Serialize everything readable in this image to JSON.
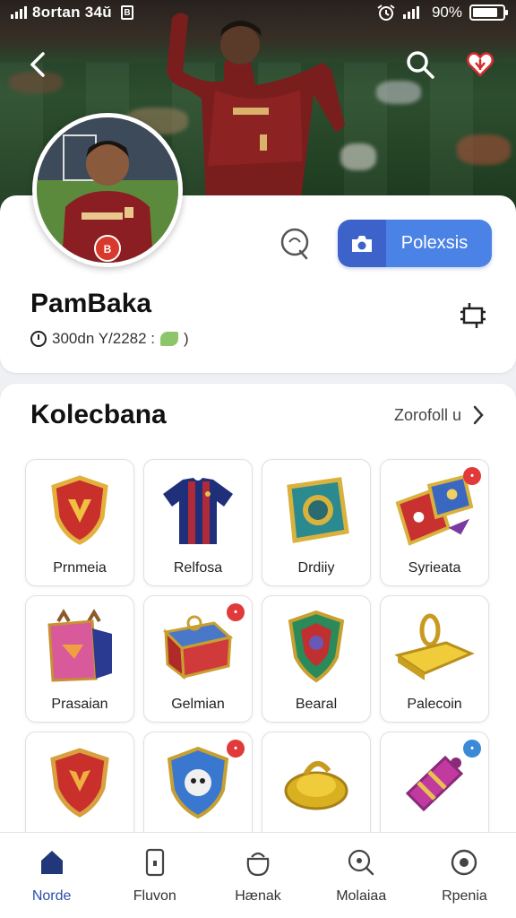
{
  "status_bar": {
    "carrier": "8ortan 34ŭ",
    "sim": "B",
    "battery_text": "90%",
    "battery_level": 0.85
  },
  "header": {
    "back_icon": "back-arrow-icon",
    "search_icon": "search-icon",
    "favorite_icon": "heart-icon"
  },
  "profile": {
    "username": "PamBaka",
    "meta": "300dn Y/2282 :",
    "meta_suffix": ")",
    "primary_button_label": "Polexsis",
    "colors": {
      "accent": "#4b82e6",
      "accent_dark": "#3d62c9"
    }
  },
  "collection": {
    "title": "Kolecbana",
    "link_label": "Zorofoll u",
    "items": [
      {
        "label": "Prnmeia",
        "icon": "crest-shield-icon",
        "badge": ""
      },
      {
        "label": "Relfosa",
        "icon": "jersey-icon",
        "badge": ""
      },
      {
        "label": "Drdiiy",
        "icon": "emblem-card-icon",
        "badge": ""
      },
      {
        "label": "Syrieata",
        "icon": "card-pack-icon",
        "badge": "red"
      },
      {
        "label": "Prasaian",
        "icon": "bag-icon",
        "badge": ""
      },
      {
        "label": "Gelmian",
        "icon": "chest-icon",
        "badge": "red"
      },
      {
        "label": "Bearal",
        "icon": "shield-emblem-icon",
        "badge": ""
      },
      {
        "label": "Palecoin",
        "icon": "gold-bar-icon",
        "badge": ""
      },
      {
        "label": "",
        "icon": "red-shield-icon",
        "badge": ""
      },
      {
        "label": "",
        "icon": "blue-badge-icon",
        "badge": "red"
      },
      {
        "label": "",
        "icon": "gold-ring-icon",
        "badge": ""
      },
      {
        "label": "",
        "icon": "scroll-icon",
        "badge": "blue"
      }
    ]
  },
  "bottom_nav": [
    {
      "label": "Norde",
      "icon": "home-icon",
      "active": true
    },
    {
      "label": "Fluvon",
      "icon": "phone-lock-icon",
      "active": false
    },
    {
      "label": "Hænak",
      "icon": "bag-outline-icon",
      "active": false
    },
    {
      "label": "Molaiaa",
      "icon": "chat-search-icon",
      "active": false
    },
    {
      "label": "Rpenia",
      "icon": "target-icon",
      "active": false
    }
  ]
}
